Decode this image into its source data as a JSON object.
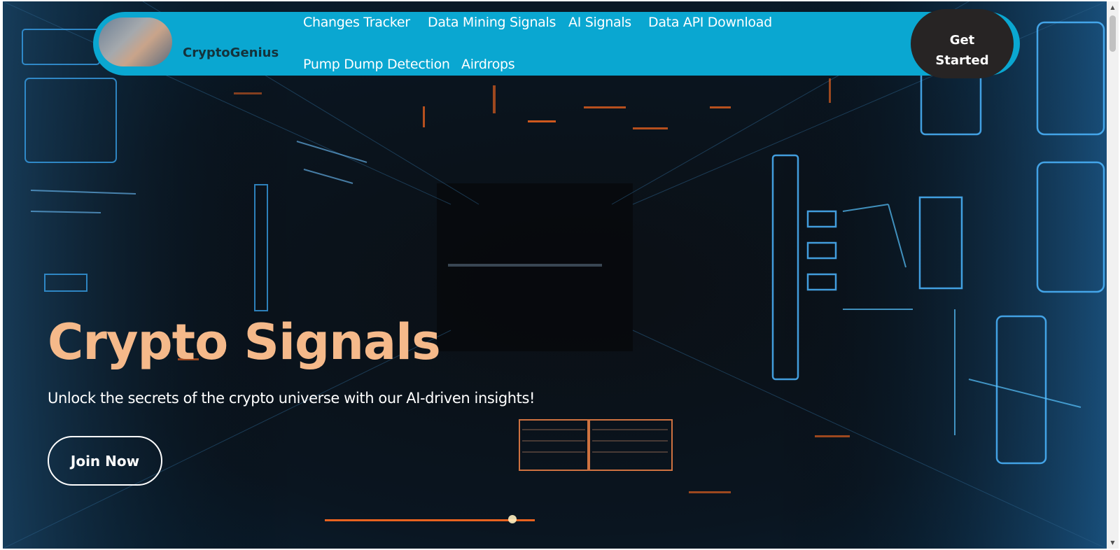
{
  "brand": {
    "name": "CryptoGenius"
  },
  "nav": {
    "links": [
      "Changes Tracker",
      "Data Mining Signals",
      "AI Signals",
      "Data API Download",
      "Pump Dump Detection",
      "Airdrops"
    ],
    "cta_line1": "Get",
    "cta_line2": "Started"
  },
  "hero": {
    "title": "Crypto Signals",
    "subtitle": "Unlock the secrets of the crypto universe with our AI-driven insights!",
    "button": "Join Now"
  },
  "colors": {
    "nav_bg": "#0aa7d1",
    "cta_bg": "#272424",
    "title": "#f5b98a"
  },
  "icons": {
    "scroll_up": "triangle-up-icon",
    "scroll_down": "triangle-down-icon"
  }
}
